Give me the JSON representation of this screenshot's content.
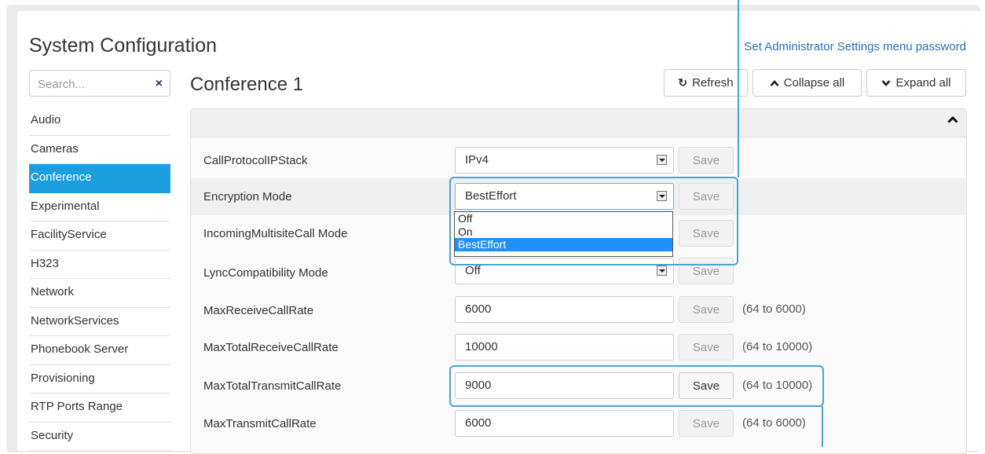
{
  "header": {
    "title": "System Configuration",
    "admin_link": "Set Administrator Settings menu password"
  },
  "search": {
    "placeholder": "Search...",
    "clear_icon": "×"
  },
  "sidebar": {
    "items": [
      {
        "label": "Audio",
        "active": false
      },
      {
        "label": "Cameras",
        "active": false
      },
      {
        "label": "Conference",
        "active": true
      },
      {
        "label": "Experimental",
        "active": false
      },
      {
        "label": "FacilityService",
        "active": false
      },
      {
        "label": "H323",
        "active": false
      },
      {
        "label": "Network",
        "active": false
      },
      {
        "label": "NetworkServices",
        "active": false
      },
      {
        "label": "Phonebook Server",
        "active": false
      },
      {
        "label": "Provisioning",
        "active": false
      },
      {
        "label": "RTP Ports Range",
        "active": false
      },
      {
        "label": "Security",
        "active": false
      }
    ]
  },
  "main": {
    "title": "Conference 1",
    "refresh_label": "Refresh",
    "collapse_label": "Collapse all",
    "expand_label": "Expand all",
    "save_label": "Save",
    "rows": [
      {
        "label": "CallProtocolIPStack",
        "value": "IPv4",
        "type": "select",
        "range": ""
      },
      {
        "label": "Encryption Mode",
        "value": "BestEffort",
        "type": "select",
        "range": ""
      },
      {
        "label": "IncomingMultisiteCall Mode",
        "value": "",
        "type": "select",
        "range": ""
      },
      {
        "label": "LyncCompatibility Mode",
        "value": "Off",
        "type": "select",
        "range": ""
      },
      {
        "label": "MaxReceiveCallRate",
        "value": "6000",
        "type": "input",
        "range": "(64 to 6000)"
      },
      {
        "label": "MaxTotalReceiveCallRate",
        "value": "10000",
        "type": "input",
        "range": "(64 to 10000)"
      },
      {
        "label": "MaxTotalTransmitCallRate",
        "value": "9000",
        "type": "input",
        "range": "(64 to 10000)"
      },
      {
        "label": "MaxTransmitCallRate",
        "value": "6000",
        "type": "input",
        "range": "(64 to 6000)"
      }
    ],
    "encryption_options": [
      "Off",
      "On",
      "BestEffort"
    ]
  },
  "colors": {
    "accent": "#1a9ee0",
    "callout": "#4aa3d6",
    "link": "#2a70b8"
  }
}
